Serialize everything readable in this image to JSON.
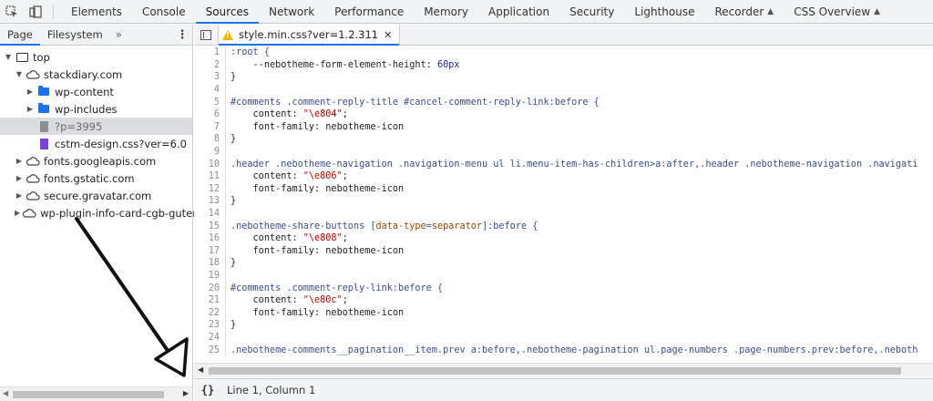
{
  "toolbar": {
    "inspect_icon": "inspect-element-icon",
    "device_icon": "device-toolbar-icon",
    "tabs": [
      {
        "label": "Elements",
        "active": false
      },
      {
        "label": "Console",
        "active": false
      },
      {
        "label": "Sources",
        "active": true
      },
      {
        "label": "Network",
        "active": false
      },
      {
        "label": "Performance",
        "active": false
      },
      {
        "label": "Memory",
        "active": false
      },
      {
        "label": "Application",
        "active": false
      },
      {
        "label": "Security",
        "active": false
      },
      {
        "label": "Lighthouse",
        "active": false
      },
      {
        "label": "Recorder",
        "active": false,
        "experimental": true
      },
      {
        "label": "CSS Overview",
        "active": false,
        "experimental": true
      }
    ]
  },
  "navigator": {
    "tabs": [
      {
        "label": "Page",
        "active": true
      },
      {
        "label": "Filesystem",
        "active": false
      }
    ],
    "more_label": "»",
    "menu_icon": "kebab-menu-icon",
    "tree": [
      {
        "label": "top",
        "kind": "frame",
        "expanded": true,
        "level": 0
      },
      {
        "label": "stackdiary.com",
        "kind": "domain",
        "expanded": true,
        "level": 1
      },
      {
        "label": "wp-content",
        "kind": "folder",
        "expanded": false,
        "level": 2
      },
      {
        "label": "wp-includes",
        "kind": "folder",
        "expanded": false,
        "level": 2
      },
      {
        "label": "?p=3995",
        "kind": "file",
        "selected": true,
        "level": 2
      },
      {
        "label": "cstm-design.css?ver=6.0",
        "kind": "stylesheet",
        "level": 2
      },
      {
        "label": "fonts.googleapis.com",
        "kind": "domain",
        "expanded": false,
        "level": 1
      },
      {
        "label": "fonts.gstatic.com",
        "kind": "domain",
        "expanded": false,
        "level": 1
      },
      {
        "label": "secure.gravatar.com",
        "kind": "domain",
        "expanded": false,
        "level": 1
      },
      {
        "label": "wp-plugin-info-card-cgb-guten-b",
        "kind": "domain",
        "expanded": false,
        "level": 1
      }
    ]
  },
  "editor": {
    "file_tab": "style.min.css?ver=1.2.311",
    "code_lines": [
      ":root {",
      "    --nebotheme-form-element-height: 60px",
      "}",
      "",
      "#comments .comment-reply-title #cancel-comment-reply-link:before {",
      "    content: \"\\e804\";",
      "    font-family: nebotheme-icon",
      "}",
      "",
      ".header .nebotheme-navigation .navigation-menu ul li.menu-item-has-children>a:after,.header .nebotheme-navigation .navigati",
      "    content: \"\\e806\";",
      "    font-family: nebotheme-icon",
      "}",
      "",
      ".nebotheme-share-buttons [data-type=separator]:before {",
      "    content: \"\\e808\";",
      "    font-family: nebotheme-icon",
      "}",
      "",
      "#comments .comment-reply-link:before {",
      "    content: \"\\e80c\";",
      "    font-family: nebotheme-icon",
      "}",
      "",
      ".nebotheme-comments__pagination__item.prev a:before,.nebotheme-pagination ul.page-numbers .page-numbers.prev:before,.neboth"
    ],
    "line_numbers": [
      "1",
      "2",
      "3",
      "4",
      "5",
      "6",
      "7",
      "8",
      "9",
      "10",
      "11",
      "12",
      "13",
      "14",
      "15",
      "16",
      "17",
      "18",
      "19",
      "20",
      "21",
      "22",
      "23",
      "24",
      "25"
    ]
  },
  "status": {
    "pretty_print_icon": "{}",
    "position": "Line 1, Column 1"
  },
  "colors": {
    "accent": "#1a73e8",
    "warning": "#f2b500",
    "selection": "#dadce0"
  }
}
